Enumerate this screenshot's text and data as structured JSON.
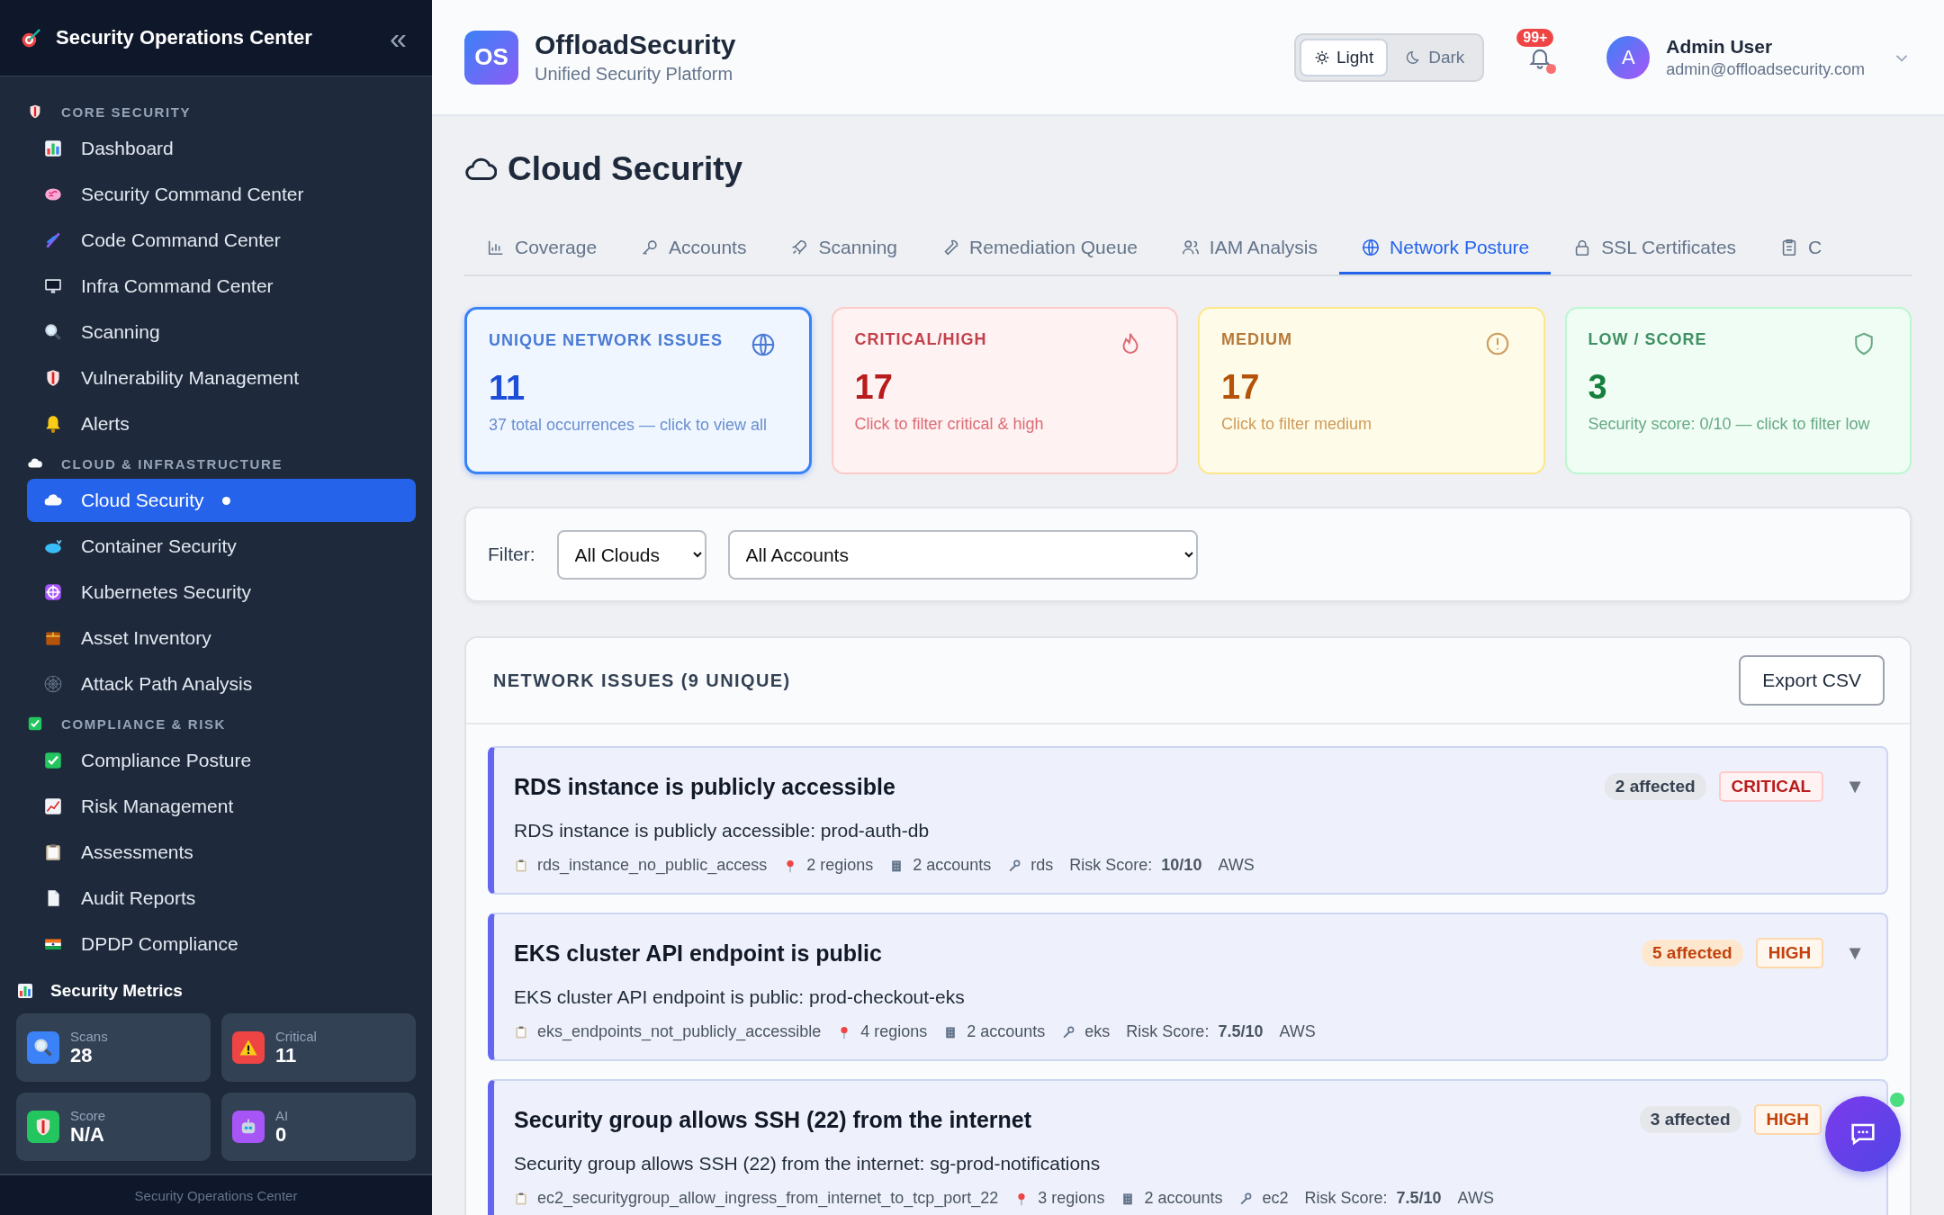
{
  "sidebar": {
    "title": "Security Operations Center",
    "collapse": "«",
    "sections": [
      {
        "label": "CORE SECURITY",
        "items": [
          {
            "label": "Dashboard",
            "selected": false
          },
          {
            "label": "Security Command Center",
            "selected": false
          },
          {
            "label": "Code Command Center",
            "selected": false
          },
          {
            "label": "Infra Command Center",
            "selected": false
          },
          {
            "label": "Scanning",
            "selected": false
          },
          {
            "label": "Vulnerability Management",
            "selected": false
          },
          {
            "label": "Alerts",
            "selected": false
          }
        ]
      },
      {
        "label": "CLOUD & INFRASTRUCTURE",
        "items": [
          {
            "label": "Cloud Security",
            "selected": true
          },
          {
            "label": "Container Security",
            "selected": false
          },
          {
            "label": "Kubernetes Security",
            "selected": false
          },
          {
            "label": "Asset Inventory",
            "selected": false
          },
          {
            "label": "Attack Path Analysis",
            "selected": false
          }
        ]
      },
      {
        "label": "COMPLIANCE & RISK",
        "items": [
          {
            "label": "Compliance Posture",
            "selected": false
          },
          {
            "label": "Risk Management",
            "selected": false
          },
          {
            "label": "Assessments",
            "selected": false
          },
          {
            "label": "Audit Reports",
            "selected": false
          },
          {
            "label": "DPDP Compliance",
            "selected": false
          }
        ]
      }
    ],
    "metrics_title": "Security Metrics",
    "metrics": [
      {
        "label": "Scans",
        "value": "28"
      },
      {
        "label": "Critical",
        "value": "11"
      },
      {
        "label": "Score",
        "value": "N/A"
      },
      {
        "label": "AI",
        "value": "0"
      }
    ],
    "footer": "Security Operations Center"
  },
  "header": {
    "logo": "OS",
    "brand": "OffloadSecurity",
    "tagline": "Unified Security Platform",
    "theme": [
      {
        "label": "Light",
        "selected": true
      },
      {
        "label": "Dark",
        "selected": false
      }
    ],
    "notifications": "99+",
    "avatar": "A",
    "user": "Admin User",
    "email": "admin@offloadsecurity.com"
  },
  "page_title": "Cloud Security",
  "tabs": [
    {
      "label": "Coverage",
      "selected": false
    },
    {
      "label": "Accounts",
      "selected": false
    },
    {
      "label": "Scanning",
      "selected": false
    },
    {
      "label": "Remediation Queue",
      "selected": false
    },
    {
      "label": "IAM Analysis",
      "selected": false
    },
    {
      "label": "Network Posture",
      "selected": true
    },
    {
      "label": "SSL Certificates",
      "selected": false
    },
    {
      "label": "C",
      "selected": false
    }
  ],
  "stats": [
    {
      "kind": "total",
      "title": "UNIQUE NETWORK ISSUES",
      "value": "11",
      "note": "37 total occurrences — click to view all",
      "selected": true
    },
    {
      "kind": "critical",
      "title": "CRITICAL/HIGH",
      "value": "17",
      "note": "Click to filter critical & high",
      "selected": false
    },
    {
      "kind": "medium",
      "title": "MEDIUM",
      "value": "17",
      "note": "Click to filter medium",
      "selected": false
    },
    {
      "kind": "low",
      "title": "LOW / SCORE",
      "value": "3",
      "note": "Security score: 0/10 — click to filter low",
      "selected": false
    }
  ],
  "filter": {
    "label": "Filter:",
    "cloud": "All Clouds",
    "account": "All Accounts"
  },
  "issues_panel": {
    "title": "NETWORK ISSUES (9 UNIQUE)",
    "export": "Export CSV",
    "issues": [
      {
        "kind": "critical",
        "title": "RDS instance is publicly accessible",
        "affected": "2 affected",
        "affected_highlight": false,
        "severity": "CRITICAL",
        "toggle": "▼",
        "description": "RDS instance is publicly accessible: prod-auth-db",
        "check": "rds_instance_no_public_access",
        "regions": "2 regions",
        "accounts": "2 accounts",
        "service": "rds",
        "risk": "Risk Score: **10/10**",
        "provider": "AWS"
      },
      {
        "kind": "high",
        "title": "EKS cluster API endpoint is public",
        "affected": "5 affected",
        "affected_highlight": true,
        "severity": "HIGH",
        "toggle": "▼",
        "description": "EKS cluster API endpoint is public: prod-checkout-eks",
        "check": "eks_endpoints_not_publicly_accessible",
        "regions": "4 regions",
        "accounts": "2 accounts",
        "service": "eks",
        "risk": "Risk Score: **7.5/10**",
        "provider": "AWS"
      },
      {
        "kind": "high",
        "title": "Security group allows SSH (22) from the internet",
        "affected": "3 affected",
        "affected_highlight": false,
        "severity": "HIGH",
        "description": "Security group allows SSH (22) from the internet: sg-prod-notifications",
        "check": "ec2_securitygroup_allow_ingress_from_internet_to_tcp_port_22",
        "regions": "3 regions",
        "accounts": "2 accounts",
        "service": "ec2",
        "risk": "Risk Score: **7.5/10**",
        "provider": "AWS"
      }
    ]
  }
}
